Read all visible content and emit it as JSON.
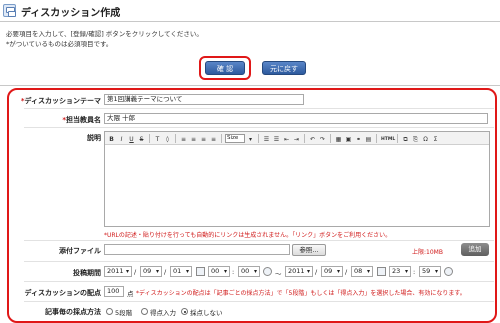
{
  "header": {
    "title": "ディスカッション作成"
  },
  "instructions": {
    "line1": "必要項目を入力して、[登録/確認] ボタンをクリックしてください。",
    "line2": "*がついているものは必須項目です。"
  },
  "actions": {
    "confirm_label": "確 認",
    "back_label": "元に戻す"
  },
  "form": {
    "theme": {
      "label": "ディスカッションテーマ",
      "value": "第1回講義テーマについて"
    },
    "teacher": {
      "label": "担当教員名",
      "value": "大隈 十郎"
    },
    "description": {
      "label": "説明",
      "note": "*URLの記述・貼り付けを行っても自動的にリンクは生成されません。「リンク」ボタンをご利用ください。",
      "toolbar": {
        "bold": "B",
        "italic": "I",
        "underline": "U",
        "strike": "S",
        "font_color": "T",
        "size": "Size",
        "html": "HTML",
        "sigma": "Σ"
      }
    },
    "attachment": {
      "label": "添付ファイル",
      "browse_label": "参照...",
      "limit": "上限:10MB",
      "add_label": "追加"
    },
    "period": {
      "label": "投稿期間",
      "start": {
        "year": "2011",
        "month": "09",
        "day": "01",
        "hour": "00",
        "minute": "00"
      },
      "end": {
        "year": "2011",
        "month": "09",
        "day": "08",
        "hour": "23",
        "minute": "59"
      },
      "sep": "/",
      "colon": ":",
      "tilde": "〜"
    },
    "points": {
      "label": "ディスカッションの配点",
      "value": "100",
      "unit": "点",
      "note": "*ディスカッションの配点は「記事ごとの採点方法」で「5段階」もしくは「得点入力」を選択した場合、有効になります。"
    },
    "scoring": {
      "label": "記事毎の採点方法",
      "options": [
        "5段階",
        "得点入力",
        "採点しない"
      ],
      "selected": "採点しない"
    }
  },
  "colors": {
    "accent": "#2d5a9e",
    "highlight": "#e01818",
    "required": "#d01818"
  }
}
